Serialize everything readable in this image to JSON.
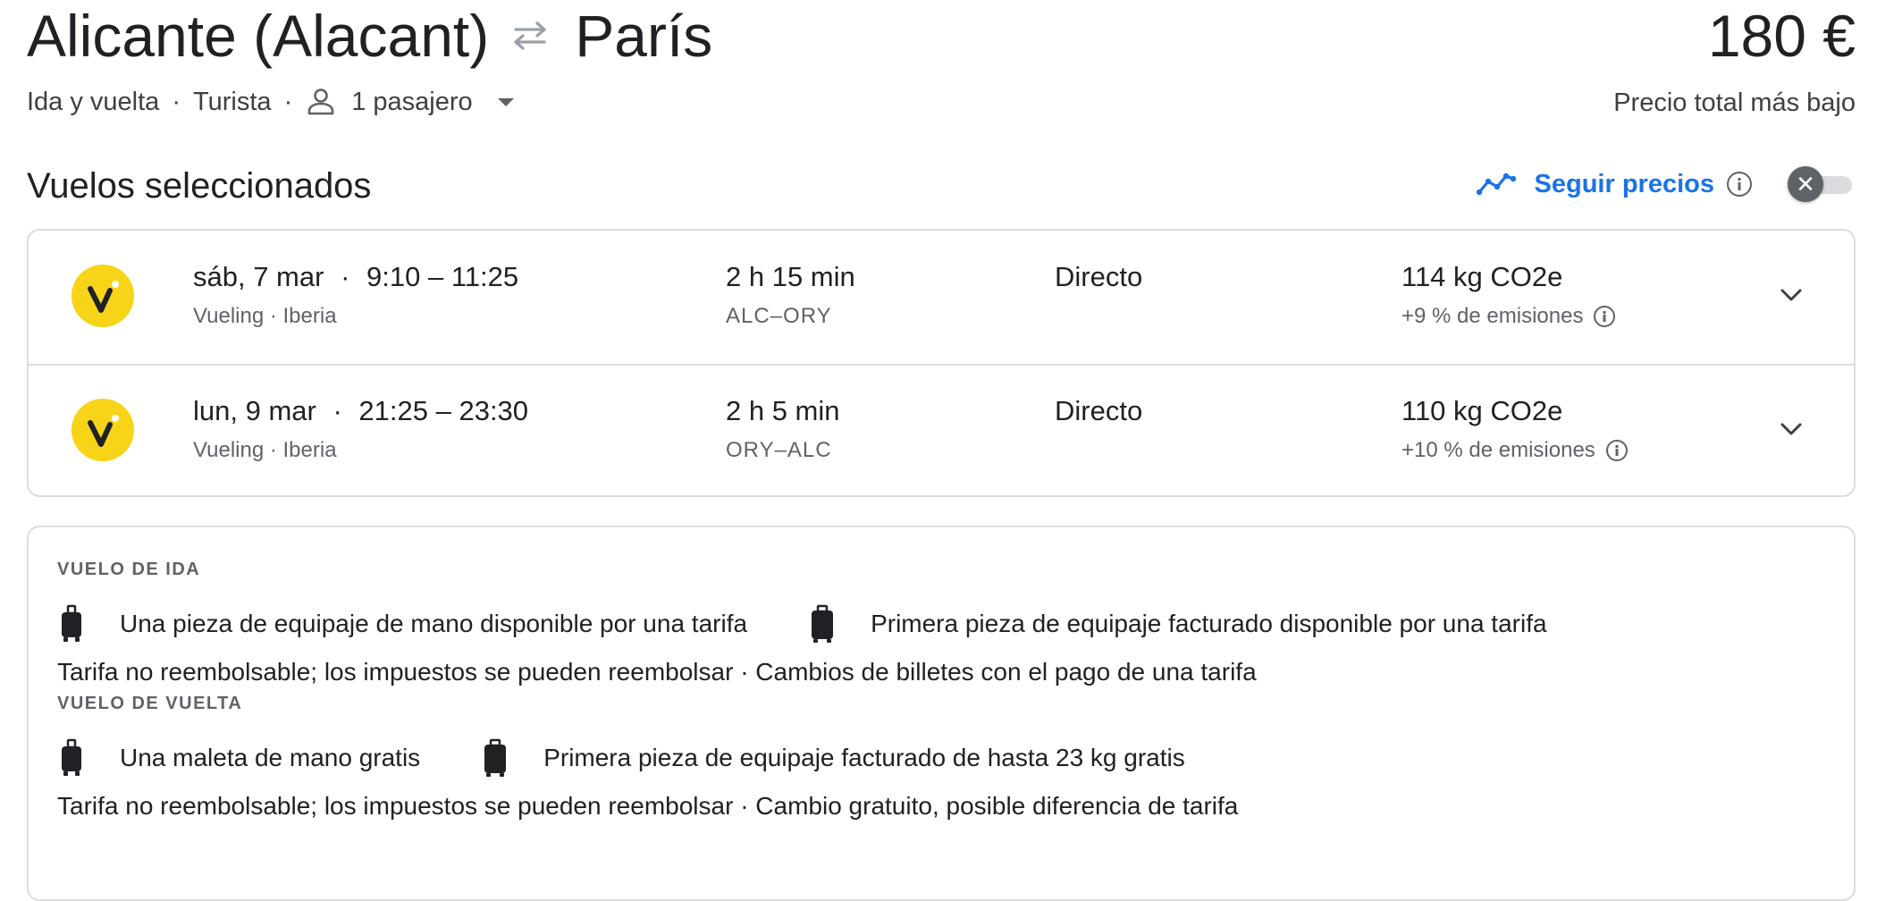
{
  "header": {
    "origin": "Alicante (Alacant)",
    "destination": "París",
    "swap_icon": "swap-arrows-icon",
    "price": "180 €",
    "price_caption": "Precio total más bajo",
    "trip_type": "Ida y vuelta",
    "cabin": "Turista",
    "passengers": "1 pasajero",
    "separator": "·"
  },
  "selected": {
    "title": "Vuelos seleccionados",
    "track_label": "Seguir precios",
    "track_enabled": false
  },
  "flights": [
    {
      "date": "sáb, 7 mar",
      "times": "9:10 – 11:25",
      "airlines": "Vueling · Iberia",
      "duration": "2 h 15 min",
      "route": "ALC–ORY",
      "stops": "Directo",
      "co2": "114 kg CO2e",
      "emissions": "+9 % de emisiones"
    },
    {
      "date": "lun, 9 mar",
      "times": "21:25 – 23:30",
      "airlines": "Vueling · Iberia",
      "duration": "2 h 5 min",
      "route": "ORY–ALC",
      "stops": "Directo",
      "co2": "110 kg CO2e",
      "emissions": "+10 % de emisiones"
    }
  ],
  "fare_details": {
    "outbound": {
      "heading": "VUELO DE IDA",
      "carry_on": "Una pieza de equipaje de mano disponible por una tarifa",
      "checked": "Primera pieza de equipaje facturado disponible por una tarifa",
      "note": "Tarifa no reembolsable; los impuestos se pueden reembolsar · Cambios de billetes con el pago de una tarifa"
    },
    "return": {
      "heading": "VUELO DE VUELTA",
      "carry_on": "Una maleta de mano gratis",
      "checked": "Primera pieza de equipaje facturado de hasta 23 kg gratis",
      "note": "Tarifa no reembolsable; los impuestos se pueden reembolsar · Cambio gratuito, posible diferencia de tarifa"
    }
  },
  "colors": {
    "accent": "#1a73e8",
    "airline_logo": "#f7d417",
    "text_primary": "#202124",
    "text_secondary": "#5f6368",
    "border": "#dadce0"
  }
}
